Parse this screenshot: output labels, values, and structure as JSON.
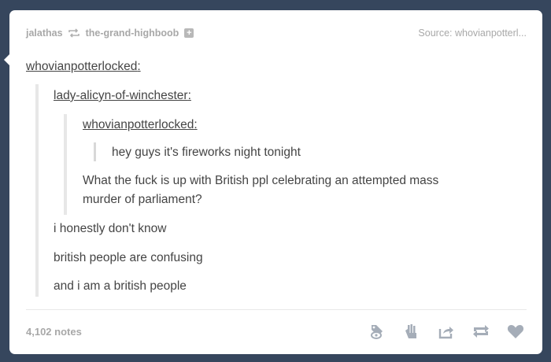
{
  "post": {
    "header": {
      "poster": "jalathas",
      "reblogged_from": "the-grand-highboob",
      "source_label": "Source: whovianpotterl..."
    },
    "thread": {
      "reblogger": "whovianpotterlocked",
      "level1_user": "lady-alicyn-of-winchester",
      "level2_user": "whovianpotterlocked",
      "original_text": "hey guys it's fireworks night tonight",
      "reply1_line1": "What the fuck is up with British ppl celebrating an attempted mass",
      "reply1_line2": "murder of parliament?",
      "reply2": "i honestly don't know",
      "reply3": "british people are confusing",
      "reply4": "and i am a british people"
    },
    "footer": {
      "notes": "4,102 notes",
      "icons": [
        "reply-icon",
        "fast-reblog-icon",
        "share-icon",
        "reblog-icon",
        "heart-icon"
      ]
    }
  },
  "colors": {
    "background": "#36465d",
    "card": "#ffffff",
    "text": "#444444",
    "muted": "#a8a8a8",
    "icon": "#a5adb8"
  }
}
